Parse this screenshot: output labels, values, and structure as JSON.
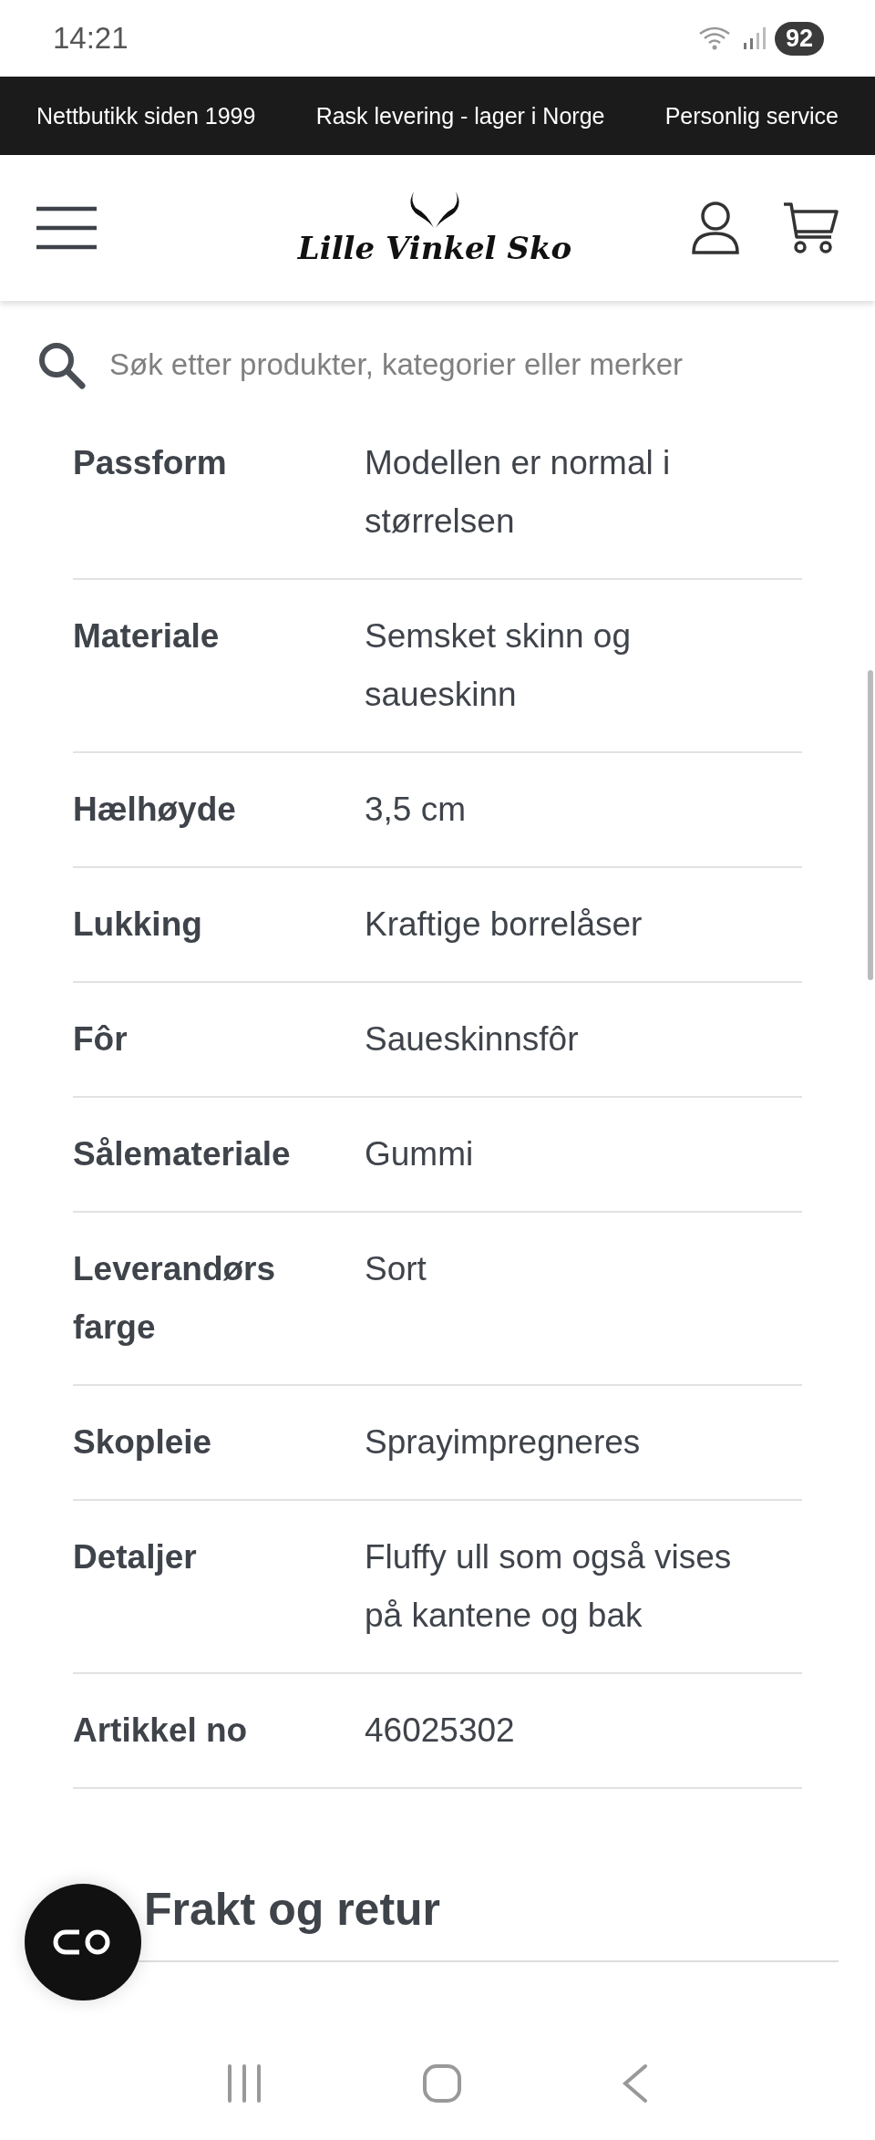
{
  "status_bar": {
    "time": "14:21",
    "battery": "92"
  },
  "promo_bar": [
    "Nettbutikk siden 1999",
    "Rask levering - lager i Norge",
    "Personlig service"
  ],
  "header": {
    "logo_text": "Lille Vinkel Sko"
  },
  "search": {
    "placeholder": "Søk etter produkter, kategorier eller merker"
  },
  "specs": [
    {
      "label": "Passform",
      "value": "Modellen er normal i størrelsen"
    },
    {
      "label": "Materiale",
      "value": "Semsket skinn og saueskinn"
    },
    {
      "label": "Hælhøyde",
      "value": "3,5 cm"
    },
    {
      "label": "Lukking",
      "value": "Kraftige borrelåser"
    },
    {
      "label": "Fôr",
      "value": "Saueskinnsfôr"
    },
    {
      "label": "Sålemateriale",
      "value": "Gummi"
    },
    {
      "label": "Leverandørs farge",
      "value": "Sort"
    },
    {
      "label": "Skopleie",
      "value": "Sprayimpregneres"
    },
    {
      "label": "Detaljer",
      "value": "Fluffy ull som også vises på kantene og bak"
    },
    {
      "label": "Artikkel no",
      "value": "46025302"
    }
  ],
  "section": {
    "title": "Frakt og retur"
  }
}
